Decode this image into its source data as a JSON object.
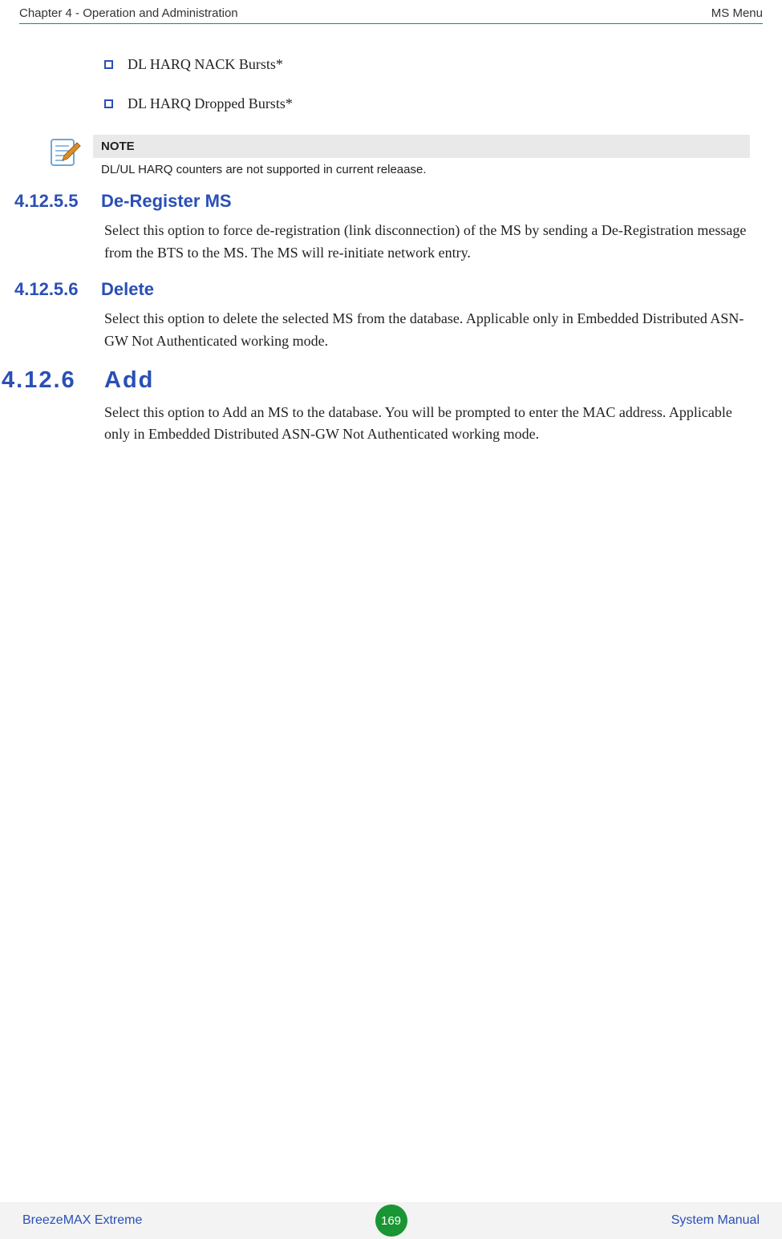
{
  "header": {
    "left": "Chapter 4 - Operation and Administration",
    "right": "MS Menu"
  },
  "bullets": [
    "DL HARQ NACK Bursts*",
    "DL HARQ Dropped Bursts*"
  ],
  "note": {
    "title": "NOTE",
    "body": "DL/UL HARQ counters are not supported in current releaase."
  },
  "sections": [
    {
      "num": "4.12.5.5",
      "title": "De-Register MS",
      "body": "Select this option to force de-registration (link disconnection) of the MS by sending a De-Registration message from the BTS to the MS. The MS will re-initiate network entry."
    },
    {
      "num": "4.12.5.6",
      "title": "Delete",
      "body": "Select this option to delete the selected MS from the database. Applicable only in Embedded Distributed ASN-GW Not Authenticated working mode."
    },
    {
      "num": "4.12.6",
      "title": "Add",
      "body": "Select this option to Add an MS to the database. You will be prompted to enter the MAC address. Applicable only in Embedded Distributed ASN-GW Not Authenticated working mode.",
      "large": true
    }
  ],
  "footer": {
    "left": "BreezeMAX Extreme",
    "page": "169",
    "right": "System Manual"
  }
}
